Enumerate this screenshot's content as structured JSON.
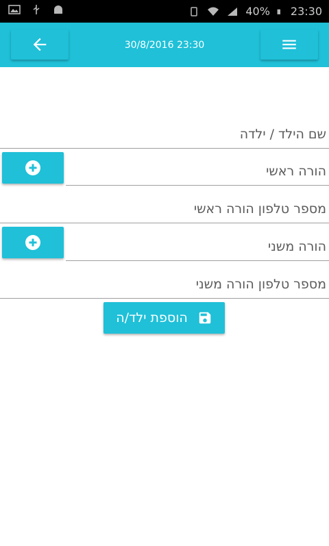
{
  "status_bar": {
    "battery_text": "40%",
    "time": "23:30"
  },
  "toolbar": {
    "title": "30/8/2016 23:30"
  },
  "form": {
    "child_name_placeholder": "שם הילד / ילדה",
    "primary_parent_placeholder": "הורה ראשי",
    "primary_parent_phone_placeholder": "מספר טלפון הורה ראשי",
    "secondary_parent_placeholder": "הורה משני",
    "secondary_parent_phone_placeholder": "מספר טלפון הורה משני",
    "save_label": "הוספת ילד/ה"
  },
  "colors": {
    "accent": "#1fc0d8",
    "status_bar": "#000000"
  },
  "icons": {
    "back": "arrow-left-icon",
    "menu": "hamburger-menu-icon",
    "add": "plus-circle-icon",
    "save": "floppy-disk-icon"
  }
}
